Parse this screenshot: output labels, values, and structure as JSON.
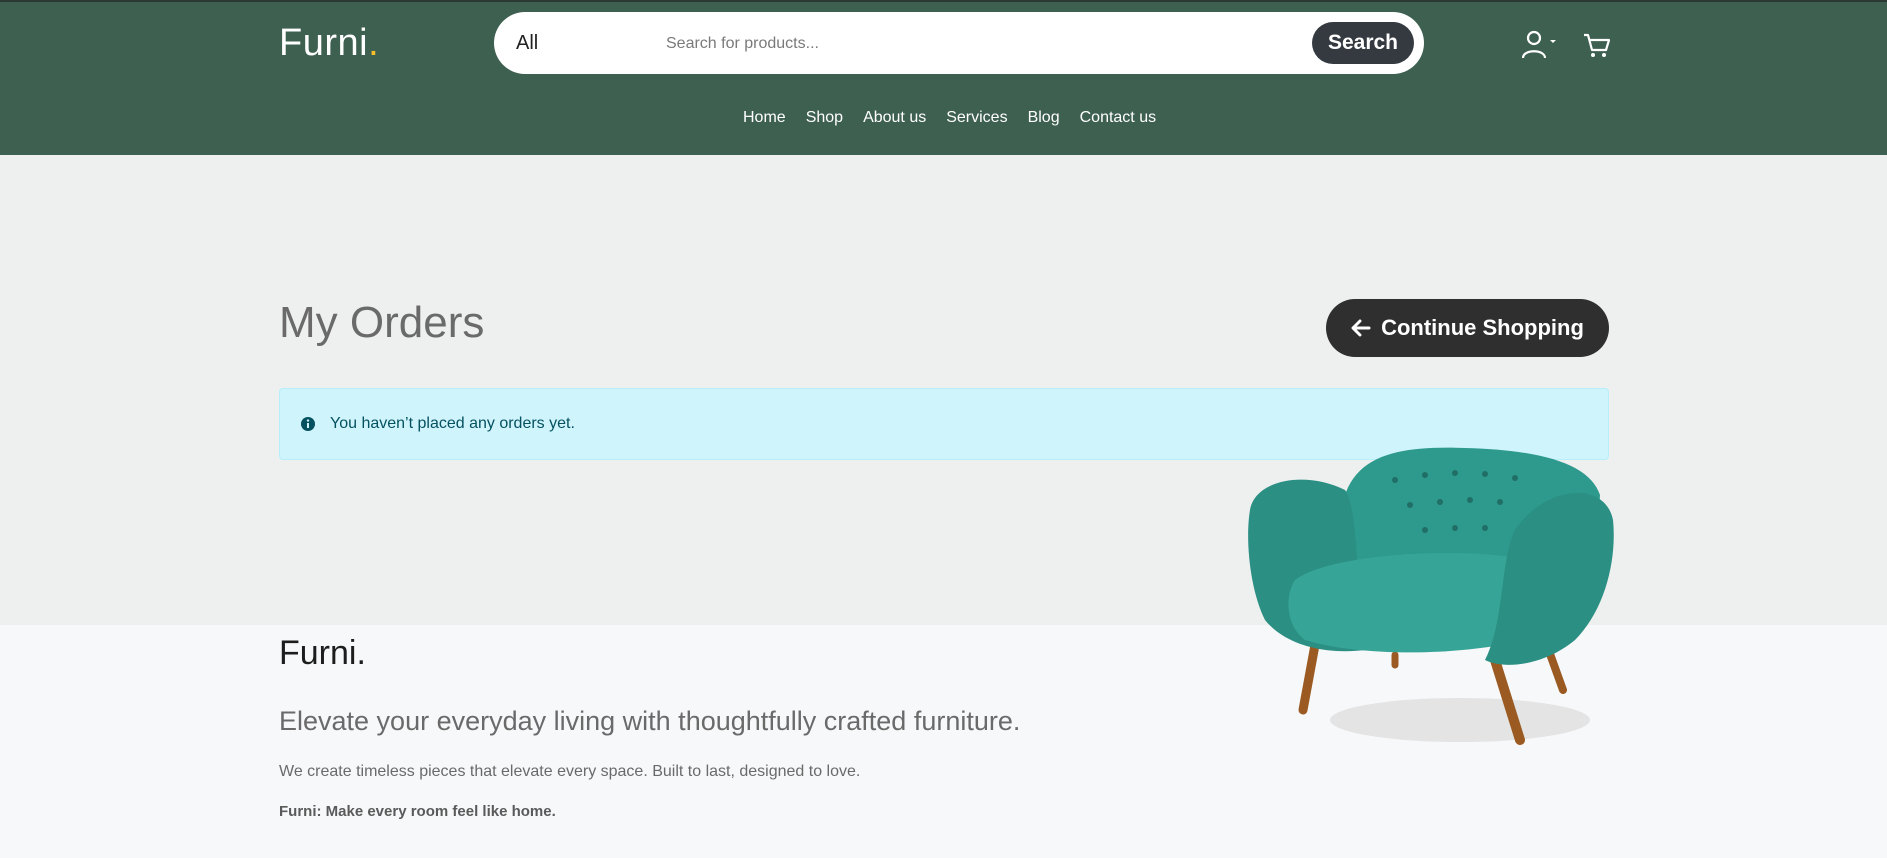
{
  "header": {
    "brand_name": "Furni",
    "brand_dot": ".",
    "search": {
      "category": "All",
      "placeholder": "Search for products...",
      "button_label": "Search"
    },
    "menu": [
      "Home",
      "Shop",
      "About us",
      "Services",
      "Blog",
      "Contact us"
    ]
  },
  "main": {
    "title": "My Orders",
    "continue_label": "Continue Shopping",
    "alert_text": "You haven’t placed any orders yet."
  },
  "footer": {
    "brand": "Furni.",
    "tagline": "Elevate your everyday living with thoughtfully crafted furniture.",
    "description": "We create timeless pieces that elevate every space. Built to last, designed to love.",
    "slogan": "Furni: Make every room feel like home."
  },
  "colors": {
    "header_bg": "#3e6051",
    "brand_dot": "#f9bf29",
    "button_dark": "#2f2f2f",
    "alert_bg": "#cff4fc",
    "chair": "#2e9a8e"
  },
  "icons": [
    "user-icon",
    "caret-down-icon",
    "cart-icon",
    "arrow-left-icon",
    "info-icon"
  ]
}
